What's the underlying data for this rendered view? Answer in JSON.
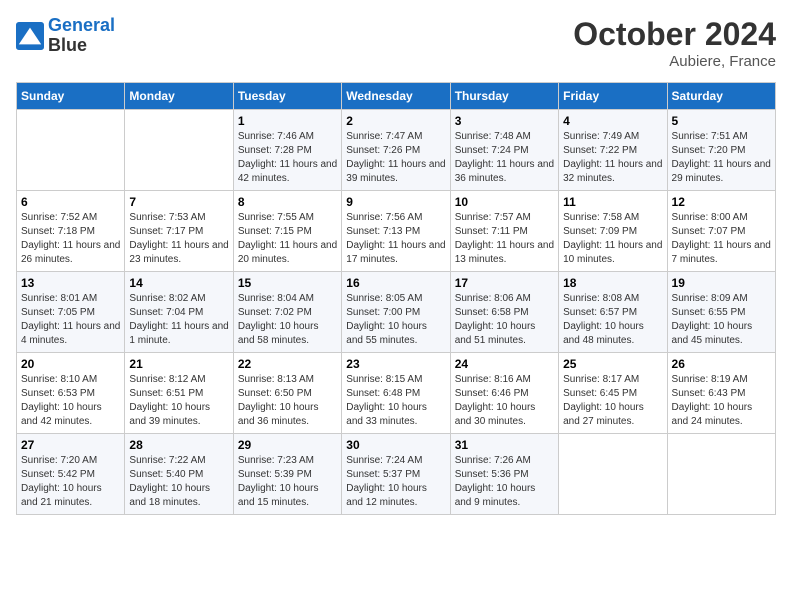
{
  "header": {
    "logo_line1": "General",
    "logo_line2": "Blue",
    "month": "October 2024",
    "location": "Aubiere, France"
  },
  "weekdays": [
    "Sunday",
    "Monday",
    "Tuesday",
    "Wednesday",
    "Thursday",
    "Friday",
    "Saturday"
  ],
  "weeks": [
    [
      {
        "day": "",
        "info": ""
      },
      {
        "day": "",
        "info": ""
      },
      {
        "day": "1",
        "info": "Sunrise: 7:46 AM\nSunset: 7:28 PM\nDaylight: 11 hours and 42 minutes."
      },
      {
        "day": "2",
        "info": "Sunrise: 7:47 AM\nSunset: 7:26 PM\nDaylight: 11 hours and 39 minutes."
      },
      {
        "day": "3",
        "info": "Sunrise: 7:48 AM\nSunset: 7:24 PM\nDaylight: 11 hours and 36 minutes."
      },
      {
        "day": "4",
        "info": "Sunrise: 7:49 AM\nSunset: 7:22 PM\nDaylight: 11 hours and 32 minutes."
      },
      {
        "day": "5",
        "info": "Sunrise: 7:51 AM\nSunset: 7:20 PM\nDaylight: 11 hours and 29 minutes."
      }
    ],
    [
      {
        "day": "6",
        "info": "Sunrise: 7:52 AM\nSunset: 7:18 PM\nDaylight: 11 hours and 26 minutes."
      },
      {
        "day": "7",
        "info": "Sunrise: 7:53 AM\nSunset: 7:17 PM\nDaylight: 11 hours and 23 minutes."
      },
      {
        "day": "8",
        "info": "Sunrise: 7:55 AM\nSunset: 7:15 PM\nDaylight: 11 hours and 20 minutes."
      },
      {
        "day": "9",
        "info": "Sunrise: 7:56 AM\nSunset: 7:13 PM\nDaylight: 11 hours and 17 minutes."
      },
      {
        "day": "10",
        "info": "Sunrise: 7:57 AM\nSunset: 7:11 PM\nDaylight: 11 hours and 13 minutes."
      },
      {
        "day": "11",
        "info": "Sunrise: 7:58 AM\nSunset: 7:09 PM\nDaylight: 11 hours and 10 minutes."
      },
      {
        "day": "12",
        "info": "Sunrise: 8:00 AM\nSunset: 7:07 PM\nDaylight: 11 hours and 7 minutes."
      }
    ],
    [
      {
        "day": "13",
        "info": "Sunrise: 8:01 AM\nSunset: 7:05 PM\nDaylight: 11 hours and 4 minutes."
      },
      {
        "day": "14",
        "info": "Sunrise: 8:02 AM\nSunset: 7:04 PM\nDaylight: 11 hours and 1 minute."
      },
      {
        "day": "15",
        "info": "Sunrise: 8:04 AM\nSunset: 7:02 PM\nDaylight: 10 hours and 58 minutes."
      },
      {
        "day": "16",
        "info": "Sunrise: 8:05 AM\nSunset: 7:00 PM\nDaylight: 10 hours and 55 minutes."
      },
      {
        "day": "17",
        "info": "Sunrise: 8:06 AM\nSunset: 6:58 PM\nDaylight: 10 hours and 51 minutes."
      },
      {
        "day": "18",
        "info": "Sunrise: 8:08 AM\nSunset: 6:57 PM\nDaylight: 10 hours and 48 minutes."
      },
      {
        "day": "19",
        "info": "Sunrise: 8:09 AM\nSunset: 6:55 PM\nDaylight: 10 hours and 45 minutes."
      }
    ],
    [
      {
        "day": "20",
        "info": "Sunrise: 8:10 AM\nSunset: 6:53 PM\nDaylight: 10 hours and 42 minutes."
      },
      {
        "day": "21",
        "info": "Sunrise: 8:12 AM\nSunset: 6:51 PM\nDaylight: 10 hours and 39 minutes."
      },
      {
        "day": "22",
        "info": "Sunrise: 8:13 AM\nSunset: 6:50 PM\nDaylight: 10 hours and 36 minutes."
      },
      {
        "day": "23",
        "info": "Sunrise: 8:15 AM\nSunset: 6:48 PM\nDaylight: 10 hours and 33 minutes."
      },
      {
        "day": "24",
        "info": "Sunrise: 8:16 AM\nSunset: 6:46 PM\nDaylight: 10 hours and 30 minutes."
      },
      {
        "day": "25",
        "info": "Sunrise: 8:17 AM\nSunset: 6:45 PM\nDaylight: 10 hours and 27 minutes."
      },
      {
        "day": "26",
        "info": "Sunrise: 8:19 AM\nSunset: 6:43 PM\nDaylight: 10 hours and 24 minutes."
      }
    ],
    [
      {
        "day": "27",
        "info": "Sunrise: 7:20 AM\nSunset: 5:42 PM\nDaylight: 10 hours and 21 minutes."
      },
      {
        "day": "28",
        "info": "Sunrise: 7:22 AM\nSunset: 5:40 PM\nDaylight: 10 hours and 18 minutes."
      },
      {
        "day": "29",
        "info": "Sunrise: 7:23 AM\nSunset: 5:39 PM\nDaylight: 10 hours and 15 minutes."
      },
      {
        "day": "30",
        "info": "Sunrise: 7:24 AM\nSunset: 5:37 PM\nDaylight: 10 hours and 12 minutes."
      },
      {
        "day": "31",
        "info": "Sunrise: 7:26 AM\nSunset: 5:36 PM\nDaylight: 10 hours and 9 minutes."
      },
      {
        "day": "",
        "info": ""
      },
      {
        "day": "",
        "info": ""
      }
    ]
  ]
}
